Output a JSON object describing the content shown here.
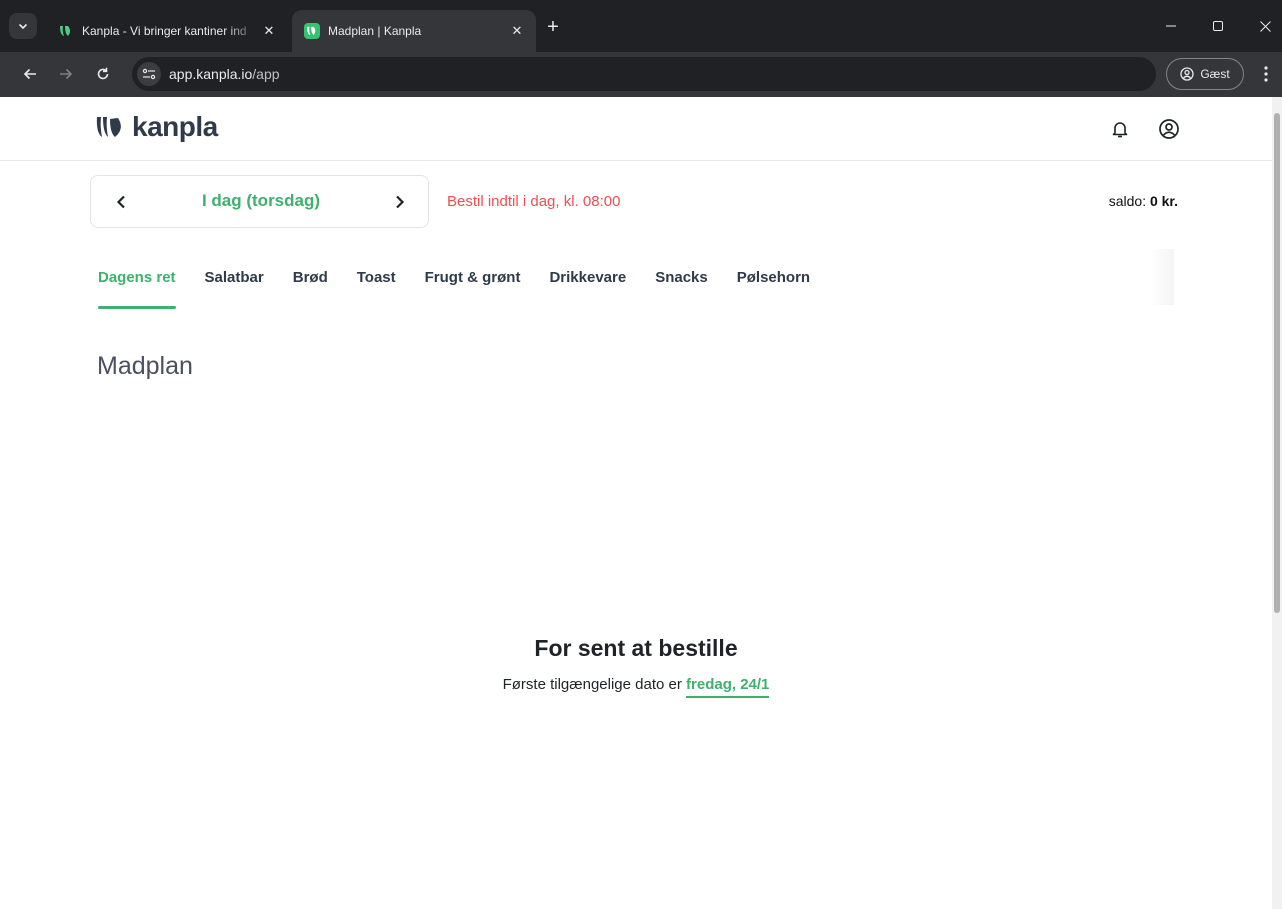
{
  "browser": {
    "tabs": [
      {
        "title": "Kanpla - Vi bringer kantiner ind",
        "active": false
      },
      {
        "title": "Madplan | Kanpla",
        "active": true
      }
    ],
    "url_host": "app.kanpla.io",
    "url_path": "/app",
    "profile_label": "Gæst"
  },
  "header": {
    "logo_text": "kanpla"
  },
  "day_nav": {
    "day_label": "I dag (torsdag)",
    "deadline": "Bestil indtil i dag, kl. 08:00",
    "saldo_label": "saldo:",
    "saldo_value": "0 kr."
  },
  "categories": [
    {
      "label": "Dagens ret",
      "active": true
    },
    {
      "label": "Salatbar",
      "active": false
    },
    {
      "label": "Brød",
      "active": false
    },
    {
      "label": "Toast",
      "active": false
    },
    {
      "label": "Frugt & grønt",
      "active": false
    },
    {
      "label": "Drikkevare",
      "active": false
    },
    {
      "label": "Snacks",
      "active": false
    },
    {
      "label": "Pølsehorn",
      "active": false
    }
  ],
  "main": {
    "section_title": "Madplan",
    "empty_title": "For sent at bestille",
    "empty_text": "Første tilgængelige dato er",
    "empty_link": "fredag, 24/1"
  },
  "colors": {
    "brand_green": "#3fb06e",
    "deadline_red": "#ef4f52",
    "text_dark": "#2f3a4a"
  }
}
